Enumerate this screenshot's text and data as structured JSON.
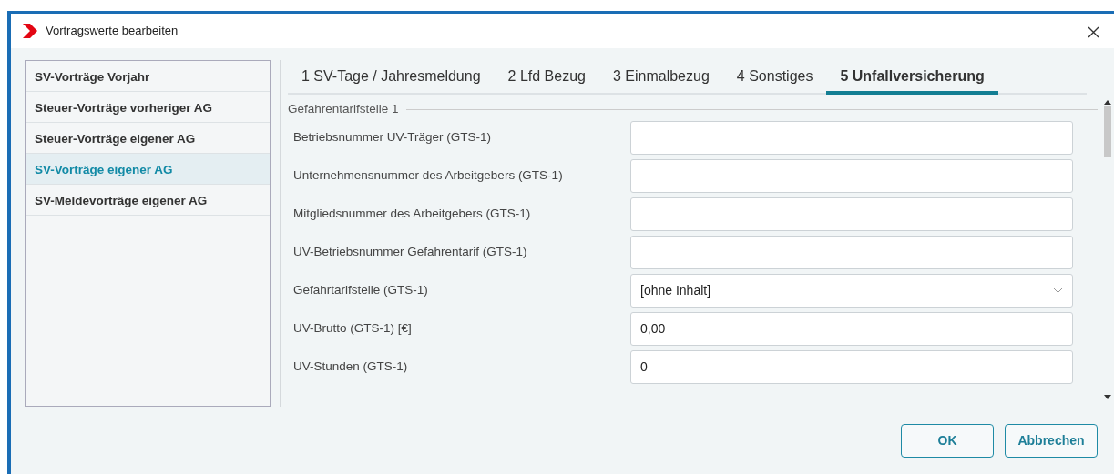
{
  "window": {
    "title": "Vortragswerte bearbeiten"
  },
  "sidebar": {
    "items": [
      {
        "label": "SV-Vorträge Vorjahr",
        "selected": false
      },
      {
        "label": "Steuer-Vorträge vorheriger AG",
        "selected": false
      },
      {
        "label": "Steuer-Vorträge eigener AG",
        "selected": false
      },
      {
        "label": "SV-Vorträge eigener AG",
        "selected": true
      },
      {
        "label": "SV-Meldevorträge eigener AG",
        "selected": false
      }
    ]
  },
  "tabs": [
    {
      "label": "1 SV-Tage / Jahresmeldung",
      "selected": false
    },
    {
      "label": "2 Lfd Bezug",
      "selected": false
    },
    {
      "label": "3 Einmalbezug",
      "selected": false
    },
    {
      "label": "4 Sonstiges",
      "selected": false
    },
    {
      "label": "5 Unfallversicherung",
      "selected": true
    }
  ],
  "section": {
    "title": "Gefahrentarifstelle 1"
  },
  "fields": [
    {
      "kind": "text",
      "label": "Betriebsnummer UV-Träger (GTS-1)"
    },
    {
      "kind": "text",
      "label": "Unternehmensnummer des Arbeitgebers (GTS-1)"
    },
    {
      "kind": "text",
      "label": "Mitgliedsnummer des Arbeitgebers (GTS-1)"
    },
    {
      "kind": "text",
      "label": "UV-Betriebsnummer Gefahrentarif (GTS-1)"
    },
    {
      "kind": "select",
      "label": "Gefahrtarifstelle (GTS-1)",
      "value": "[ohne Inhalt]"
    },
    {
      "kind": "text",
      "label": "UV-Brutto (GTS-1) [€]",
      "value": "0,00"
    },
    {
      "kind": "text",
      "label": "UV-Stunden (GTS-1)",
      "value": "0"
    }
  ],
  "buttons": [
    "OK",
    "Abbrechen"
  ]
}
